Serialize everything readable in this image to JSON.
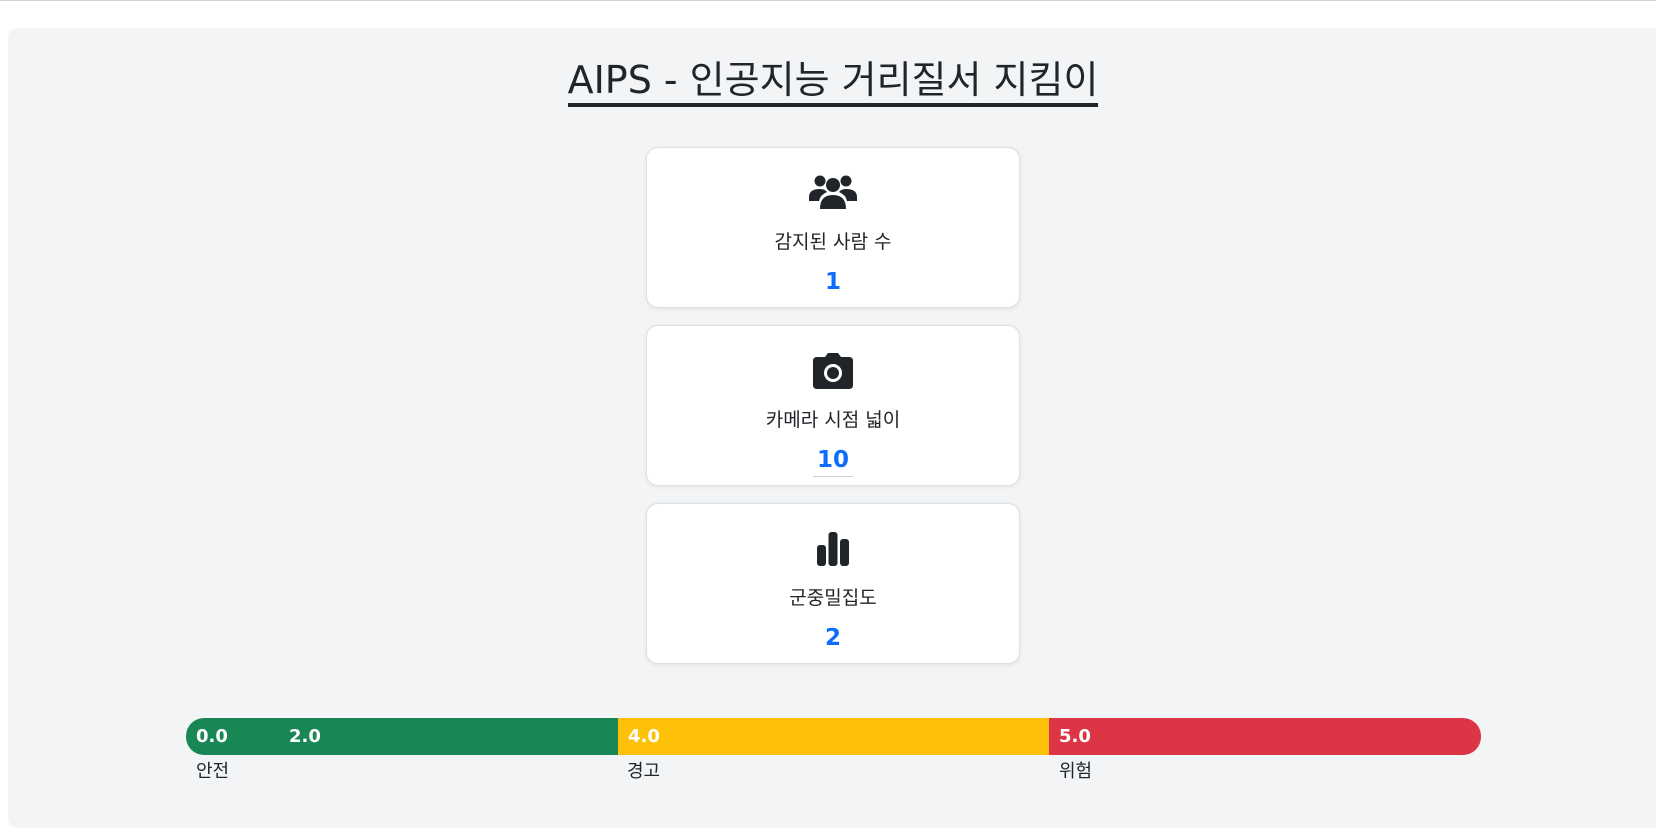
{
  "header": {
    "title": "AIPS - 인공지능 거리질서 지킴이"
  },
  "cards": [
    {
      "icon": "users-icon",
      "label": "감지된 사람 수",
      "value": "1"
    },
    {
      "icon": "camera-icon",
      "label": "카메라 시점 넓이",
      "value": "10"
    },
    {
      "icon": "bar-chart-icon",
      "label": "군중밀집도",
      "value": "2"
    }
  ],
  "density_scale": {
    "colors": {
      "safe": "#198754",
      "warning": "#ffc107",
      "danger": "#dc3545"
    },
    "ticks": {
      "t0": "0.0",
      "t1": "2.0",
      "t2": "4.0",
      "t3": "5.0"
    },
    "labels": {
      "safe": "안전",
      "warning": "경고",
      "danger": "위험"
    }
  },
  "colors": {
    "accent": "#0d6efd",
    "text": "#212529",
    "panel": "#f3f4f6"
  }
}
